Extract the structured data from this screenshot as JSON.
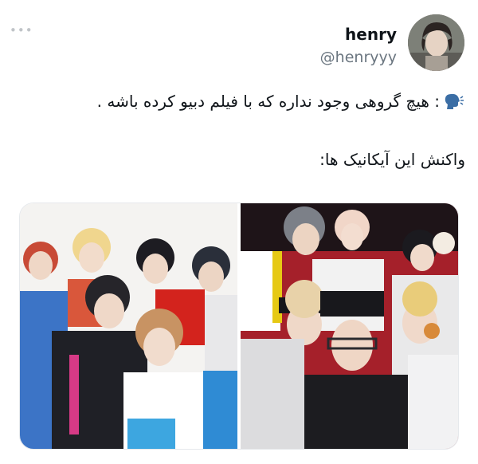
{
  "tweet": {
    "more_icon": "more-dots-icon",
    "display_name": "henry",
    "handle": "@henryyy",
    "text_line1": ": هیچ گروهی وجود نداره که با فیلم دبیو کرده باشه .",
    "speaker_icon": "speaking-head-icon",
    "text_line2": "واکنش این آیکانیک ها:"
  },
  "media": {
    "images": [
      {
        "name": "group-photo-white-background"
      },
      {
        "name": "group-photo-red-background"
      }
    ]
  },
  "colors": {
    "text": "#0f1419",
    "secondary": "#6b7680",
    "background": "#ffffff"
  }
}
